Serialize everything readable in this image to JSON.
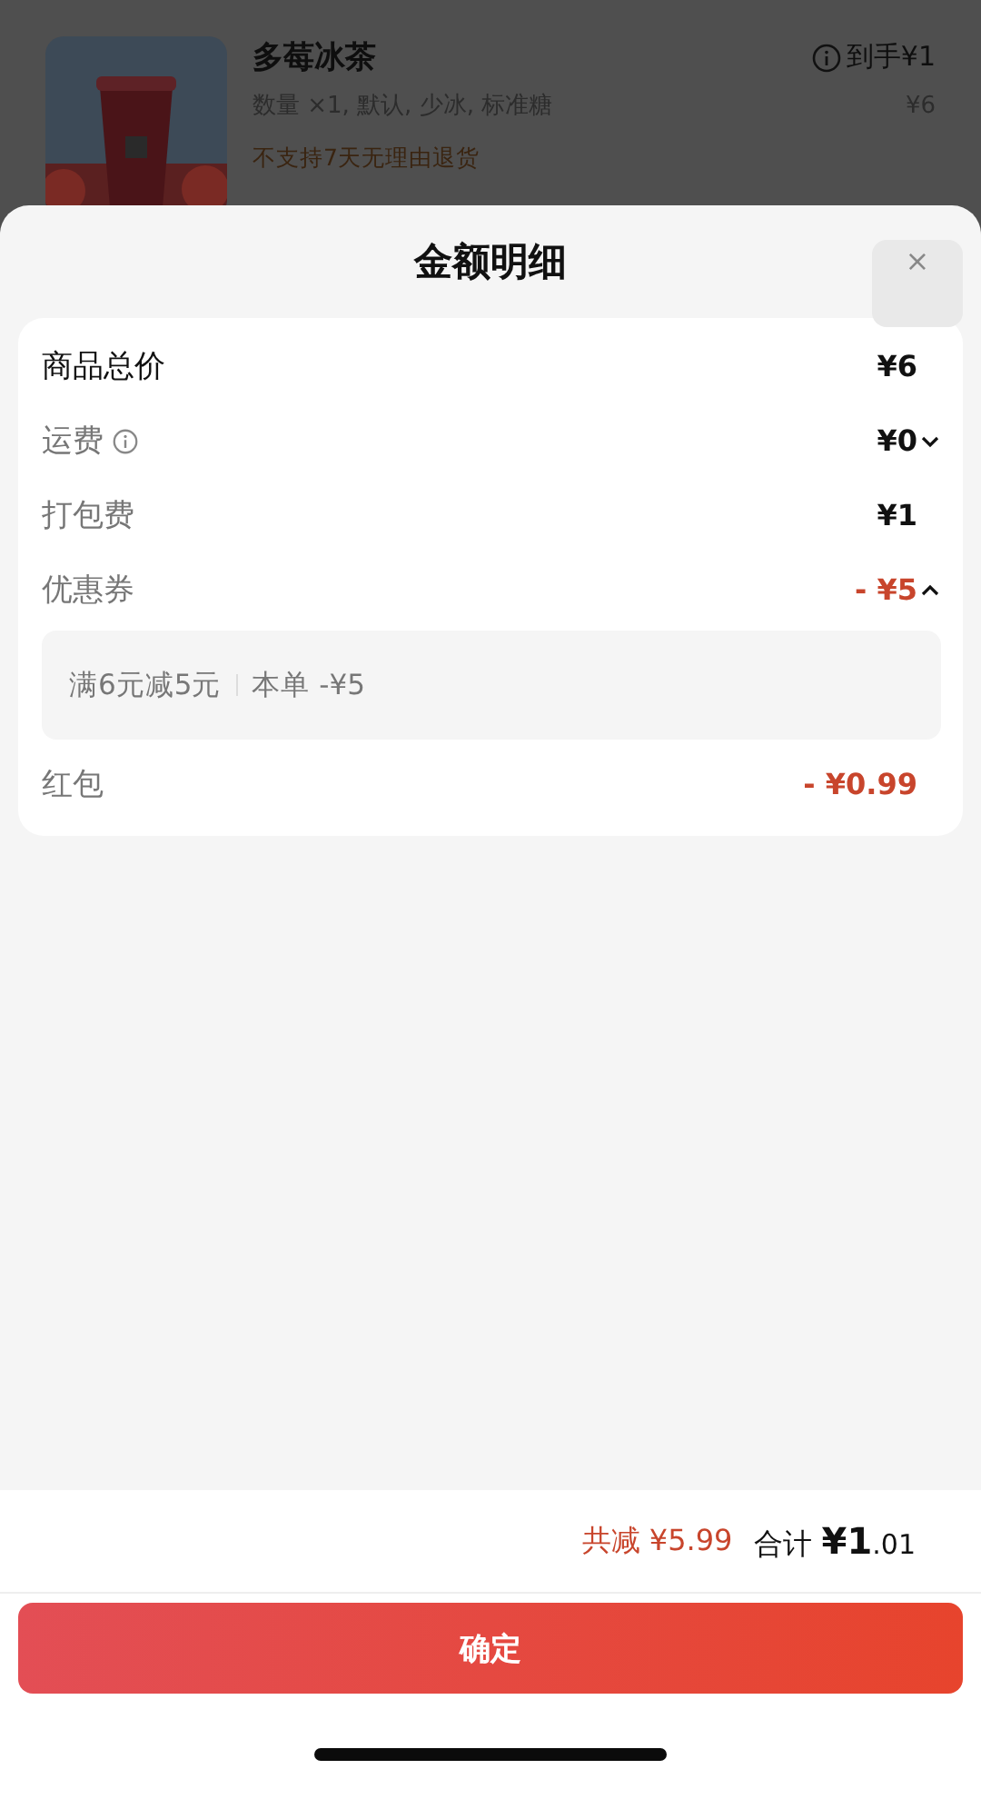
{
  "product": {
    "name": "多莓冰茶",
    "options": "数量 ×1, 默认, 少冰, 标准糖",
    "notice": "不支持7天无理由退货",
    "net_label": "到手",
    "net_price": "¥1",
    "price": "¥6"
  },
  "sheet": {
    "title": "金额明细",
    "close": "×"
  },
  "fees": [
    {
      "label": "商品总价",
      "value": "¥6",
      "kind": "strong",
      "info": false
    },
    {
      "label": "运费",
      "value": "¥0",
      "kind": "plain",
      "info": true,
      "expanded": false
    },
    {
      "label": "打包费",
      "value": "¥1",
      "kind": "plain",
      "info": false
    },
    {
      "label": "优惠券",
      "value": "- ¥5",
      "kind": "discount",
      "info": false,
      "expanded": true,
      "detail": {
        "rule": "满6元减5元",
        "amount": "本单 -¥5"
      }
    },
    {
      "label": "红包",
      "value": "- ¥0.99",
      "kind": "discount",
      "info": false
    }
  ],
  "summary": {
    "discount_label": "共减",
    "discount": "¥5.99",
    "total_label": "合计",
    "total_int": "¥1",
    "total_dec": ".01"
  },
  "confirm": "确定"
}
